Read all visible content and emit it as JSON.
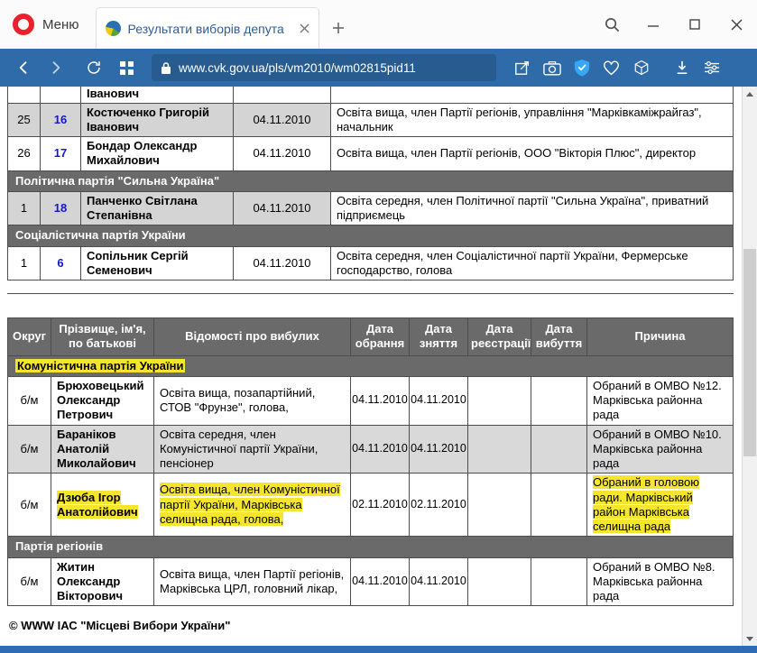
{
  "colors": {
    "address_bar_blue": "#2f6ba8",
    "table_header_gray": "#6a6a6a",
    "row_shade_gray": "#d4d4d4",
    "marker_highlight_yellow": "#f6e52e",
    "link_blue": "#1717cc",
    "opera_red": "#e8222c",
    "vpn_shield_blue": "#34a8f4"
  },
  "icons": [
    "opera-logo",
    "tab-favicon",
    "tab-close",
    "new-tab-plus",
    "search",
    "minimize",
    "maximize",
    "close",
    "back",
    "forward",
    "reload",
    "speed-dial-grid",
    "lock",
    "share-edit",
    "camera",
    "vpn-shield",
    "heart",
    "extensions-cube",
    "download",
    "settings-sliders",
    "scroll-up",
    "scroll-down"
  ],
  "browser": {
    "menu_label": "Меню",
    "tab_title": "Результати виборів депута",
    "url": "www.cvk.gov.ua/pls/vm2010/wm02815pid11"
  },
  "results_table": {
    "clipped_row": {
      "name": "Іванович"
    },
    "groups": [
      {
        "party": "",
        "rows": [
          {
            "idx": "25",
            "num": "16",
            "name": "Костюченко Григорій Іванович",
            "date": "04.11.2010",
            "info": "Освіта вища, член Партії регіонів, управління \"Марківкаміжрайгаз\", начальник"
          },
          {
            "idx": "26",
            "num": "17",
            "name": "Бондар Олександр Михайлович",
            "date": "04.11.2010",
            "info": "Освіта вища, член Партії регіонів, ООО \"Вікторія Плюс\", директор"
          }
        ]
      },
      {
        "party": "Політична партія \"Сильна Україна\"",
        "rows": [
          {
            "idx": "1",
            "num": "18",
            "name": "Панченко Світлана Степанівна",
            "date": "04.11.2010",
            "info": "Освіта середня, член Політичної партії \"Сильна Україна\", приватний підприємець"
          }
        ]
      },
      {
        "party": "Соціалістична партія України",
        "rows": [
          {
            "idx": "1",
            "num": "6",
            "name": "Сопільник Сергій Семенович",
            "date": "04.11.2010",
            "info": "Освіта середня, член Соціалістичної партії України, Фермерське господарство, голова"
          }
        ]
      }
    ]
  },
  "departed_table": {
    "headers": [
      "Округ",
      "Прізвище, ім'я, по батькові",
      "Відомості про вибулих",
      "Дата обрання",
      "Дата зняття",
      "Дата реєстрації",
      "Дата вибуття",
      "Причина"
    ],
    "groups": [
      {
        "party": "Комуністична партія України",
        "rows": [
          {
            "okrug": "б/м",
            "name": "Брюховецький Олександр Петрович",
            "info": "Освіта вища, позапартійний, СТОВ \"Фрунзе\", голова,",
            "elected": "04.11.2010",
            "removed": "04.11.2010",
            "registered": "",
            "departed": "",
            "reason": "Обраний в ОМВО №12. Марківська районна рада"
          },
          {
            "okrug": "б/м",
            "name": "Бараніков Анатолій Миколайович",
            "info": "Освіта середня, член Комуністичної партії України, пенсіонер",
            "elected": "04.11.2010",
            "removed": "04.11.2010",
            "registered": "",
            "departed": "",
            "reason": "Обраний в ОМВО №10. Марківська районна рада"
          },
          {
            "okrug": "б/м",
            "name": "Дзюба Ігор Анатолійович",
            "info": "Освіта вища, член Комуністичної партії України, Марківська селищна рада, голова,",
            "elected": "02.11.2010",
            "removed": "02.11.2010",
            "registered": "",
            "departed": "",
            "reason": "Обраний в головою ради. Марківський район Марківська селищна рада"
          }
        ]
      },
      {
        "party": "Партія регіонів",
        "rows": [
          {
            "okrug": "б/м",
            "name": "Житин Олександр Вікторович",
            "info": "Освіта вища, член Партії регіонів, Марківська ЦРЛ, головний лікар,",
            "elected": "04.11.2010",
            "removed": "04.11.2010",
            "registered": "",
            "departed": "",
            "reason": "Обраний в ОМВО №8. Марківська районна рада"
          }
        ]
      }
    ]
  },
  "footer": {
    "text": "© WWW ІАС \"Місцеві Вибори України\""
  }
}
